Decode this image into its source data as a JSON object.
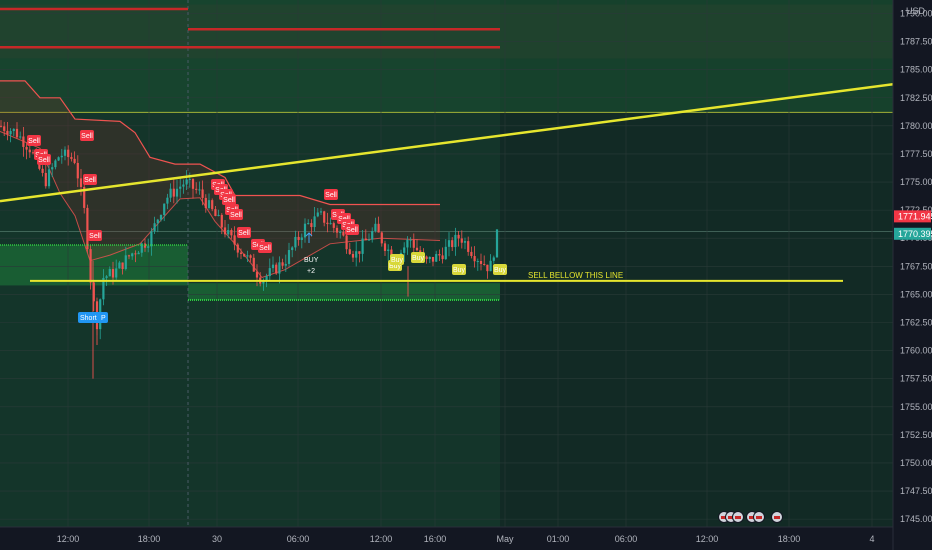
{
  "chart_data": {
    "type": "candlestick",
    "currency_label": "USD",
    "y_ticks": [
      "1790.000",
      "1787.500",
      "1785.000",
      "1782.500",
      "1780.000",
      "1777.500",
      "1775.000",
      "1772.500",
      "1770.000",
      "1767.500",
      "1765.000",
      "1762.500",
      "1760.000",
      "1757.500",
      "1755.000",
      "1752.500",
      "1750.000",
      "1747.500",
      "1745.000"
    ],
    "ylim": [
      1744.3,
      1791.2
    ],
    "x_ticks": [
      "12:00",
      "18:00",
      "30",
      "06:00",
      "12:00",
      "16:00",
      "May",
      "01:00",
      "06:00",
      "12:00",
      "18:00",
      "4"
    ],
    "price_labels": [
      {
        "value": "1771.945",
        "color": "#f23645"
      },
      {
        "value": "1770.395",
        "color": "#26a69a"
      }
    ],
    "resistance_levels": [
      1790.4,
      1788.6,
      1787.0
    ],
    "support_level": 1766.2,
    "trendline": {
      "start": 1773.3,
      "end": 1783.7,
      "color": "#e6e62e"
    },
    "annotation": "SELL BELLOW THIS LINE",
    "sell_label": "Sell",
    "buy_label": "Buy",
    "short_label": "Short",
    "p_label": "P",
    "buy_text": "BUY",
    "buy_sub": "+2",
    "colors": {
      "bg": "#131722",
      "bull": "#26a69a",
      "bear": "#ef5350",
      "band": "#ef5350",
      "green_zone": "#1f6e3a",
      "dark_zone": "#1b2b2a",
      "yellow": "#e6e62e",
      "sell_badge": "#f23645",
      "buy_badge": "#d8d83a",
      "short_badge": "#2196f3"
    }
  }
}
